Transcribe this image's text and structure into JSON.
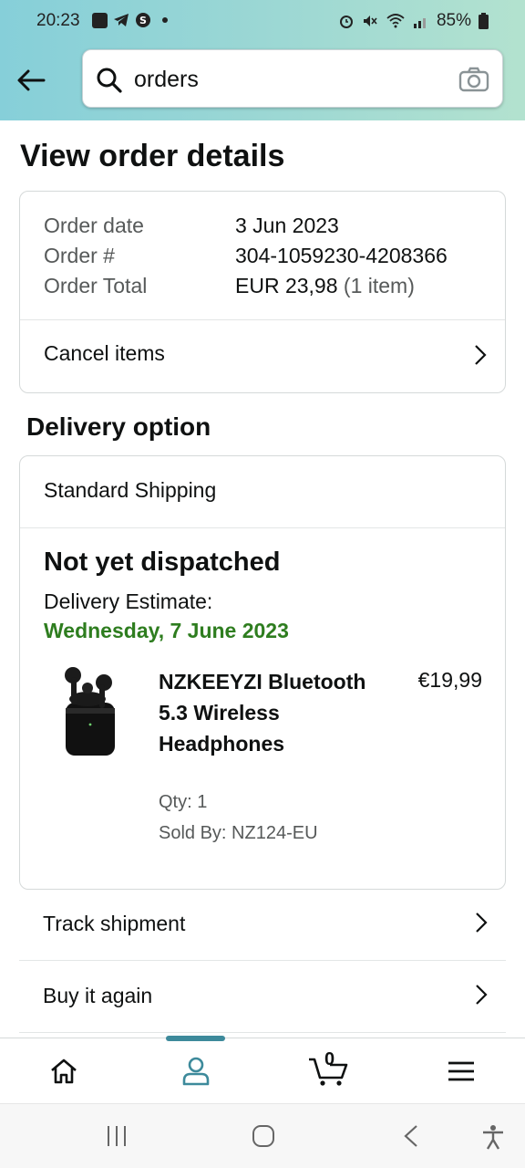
{
  "status_bar": {
    "time": "20:23",
    "battery": "85%"
  },
  "search": {
    "value": "orders",
    "placeholder": ""
  },
  "page_title": "View order details",
  "order_summary": {
    "date_label": "Order date",
    "date_value": "3 Jun 2023",
    "number_label": "Order #",
    "number_value": "304-1059230-4208366",
    "total_label": "Order Total",
    "total_value": "EUR 23,98",
    "total_items": "(1 item)",
    "cancel_label": "Cancel items"
  },
  "delivery": {
    "section_title": "Delivery option",
    "shipping_method": "Standard Shipping",
    "status": "Not yet dispatched",
    "estimate_label": "Delivery Estimate:",
    "estimate_date": "Wednesday, 7 June 2023",
    "accent_color": "#2e7d1f",
    "item": {
      "name": "NZKEEYZI Bluetooth 5.3 Wireless Headphones",
      "price": "€19,99",
      "qty": "Qty: 1",
      "sold_by": "Sold By: NZ124-EU"
    }
  },
  "actions": {
    "track": "Track shipment",
    "buy_again": "Buy it again"
  },
  "bottom_nav": {
    "cart_count": "0",
    "active": "profile"
  },
  "theme": {
    "header_gradient_start": "#86cfd9",
    "header_gradient_end": "#b3e2cf",
    "active_tab": "#3d8a9b"
  }
}
